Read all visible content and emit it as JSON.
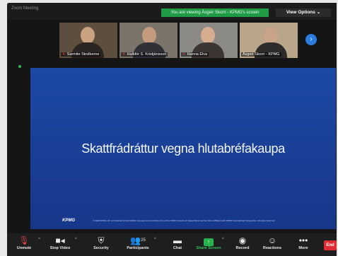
{
  "app": {
    "title": "Zoom Meeting",
    "sharing_banner": "You are viewing Ásgeir Skorri - KPMG's screen",
    "view_options": "View Options ⌄"
  },
  "gallery": {
    "participants": [
      {
        "name": "Sarmite Strelberne",
        "muted": true
      },
      {
        "name": "Halldór S. Kristjánsson",
        "muted": true
      },
      {
        "name": "Hanna Elva",
        "muted": true
      },
      {
        "name": "Ásgeir Skorri - KPMG",
        "muted": false
      }
    ],
    "next_icon": "chevron-right-icon"
  },
  "shared_slide": {
    "title": "Skattfrádráttur vegna hlutabréfakaupa",
    "logo": "KPMG",
    "footer": "© 2020 KPMG ehf. an Icelandic limited liability company and a member firm of the KPMG network of independent member firms affiliated with KPMG International Cooperative. All rights reserved."
  },
  "toolbar": {
    "unmute": "Unmute",
    "stop_video": "Stop Video",
    "security": "Security",
    "participants": "Participants",
    "participants_count": "25",
    "chat": "Chat",
    "share_screen": "Share Screen",
    "record": "Record",
    "reactions": "Reactions",
    "more": "More",
    "end": "End"
  },
  "colors": {
    "slide_blue": "#1c49a6",
    "share_green": "#27b14f",
    "end_red": "#e02b32",
    "banner_green": "#1f9a45"
  }
}
